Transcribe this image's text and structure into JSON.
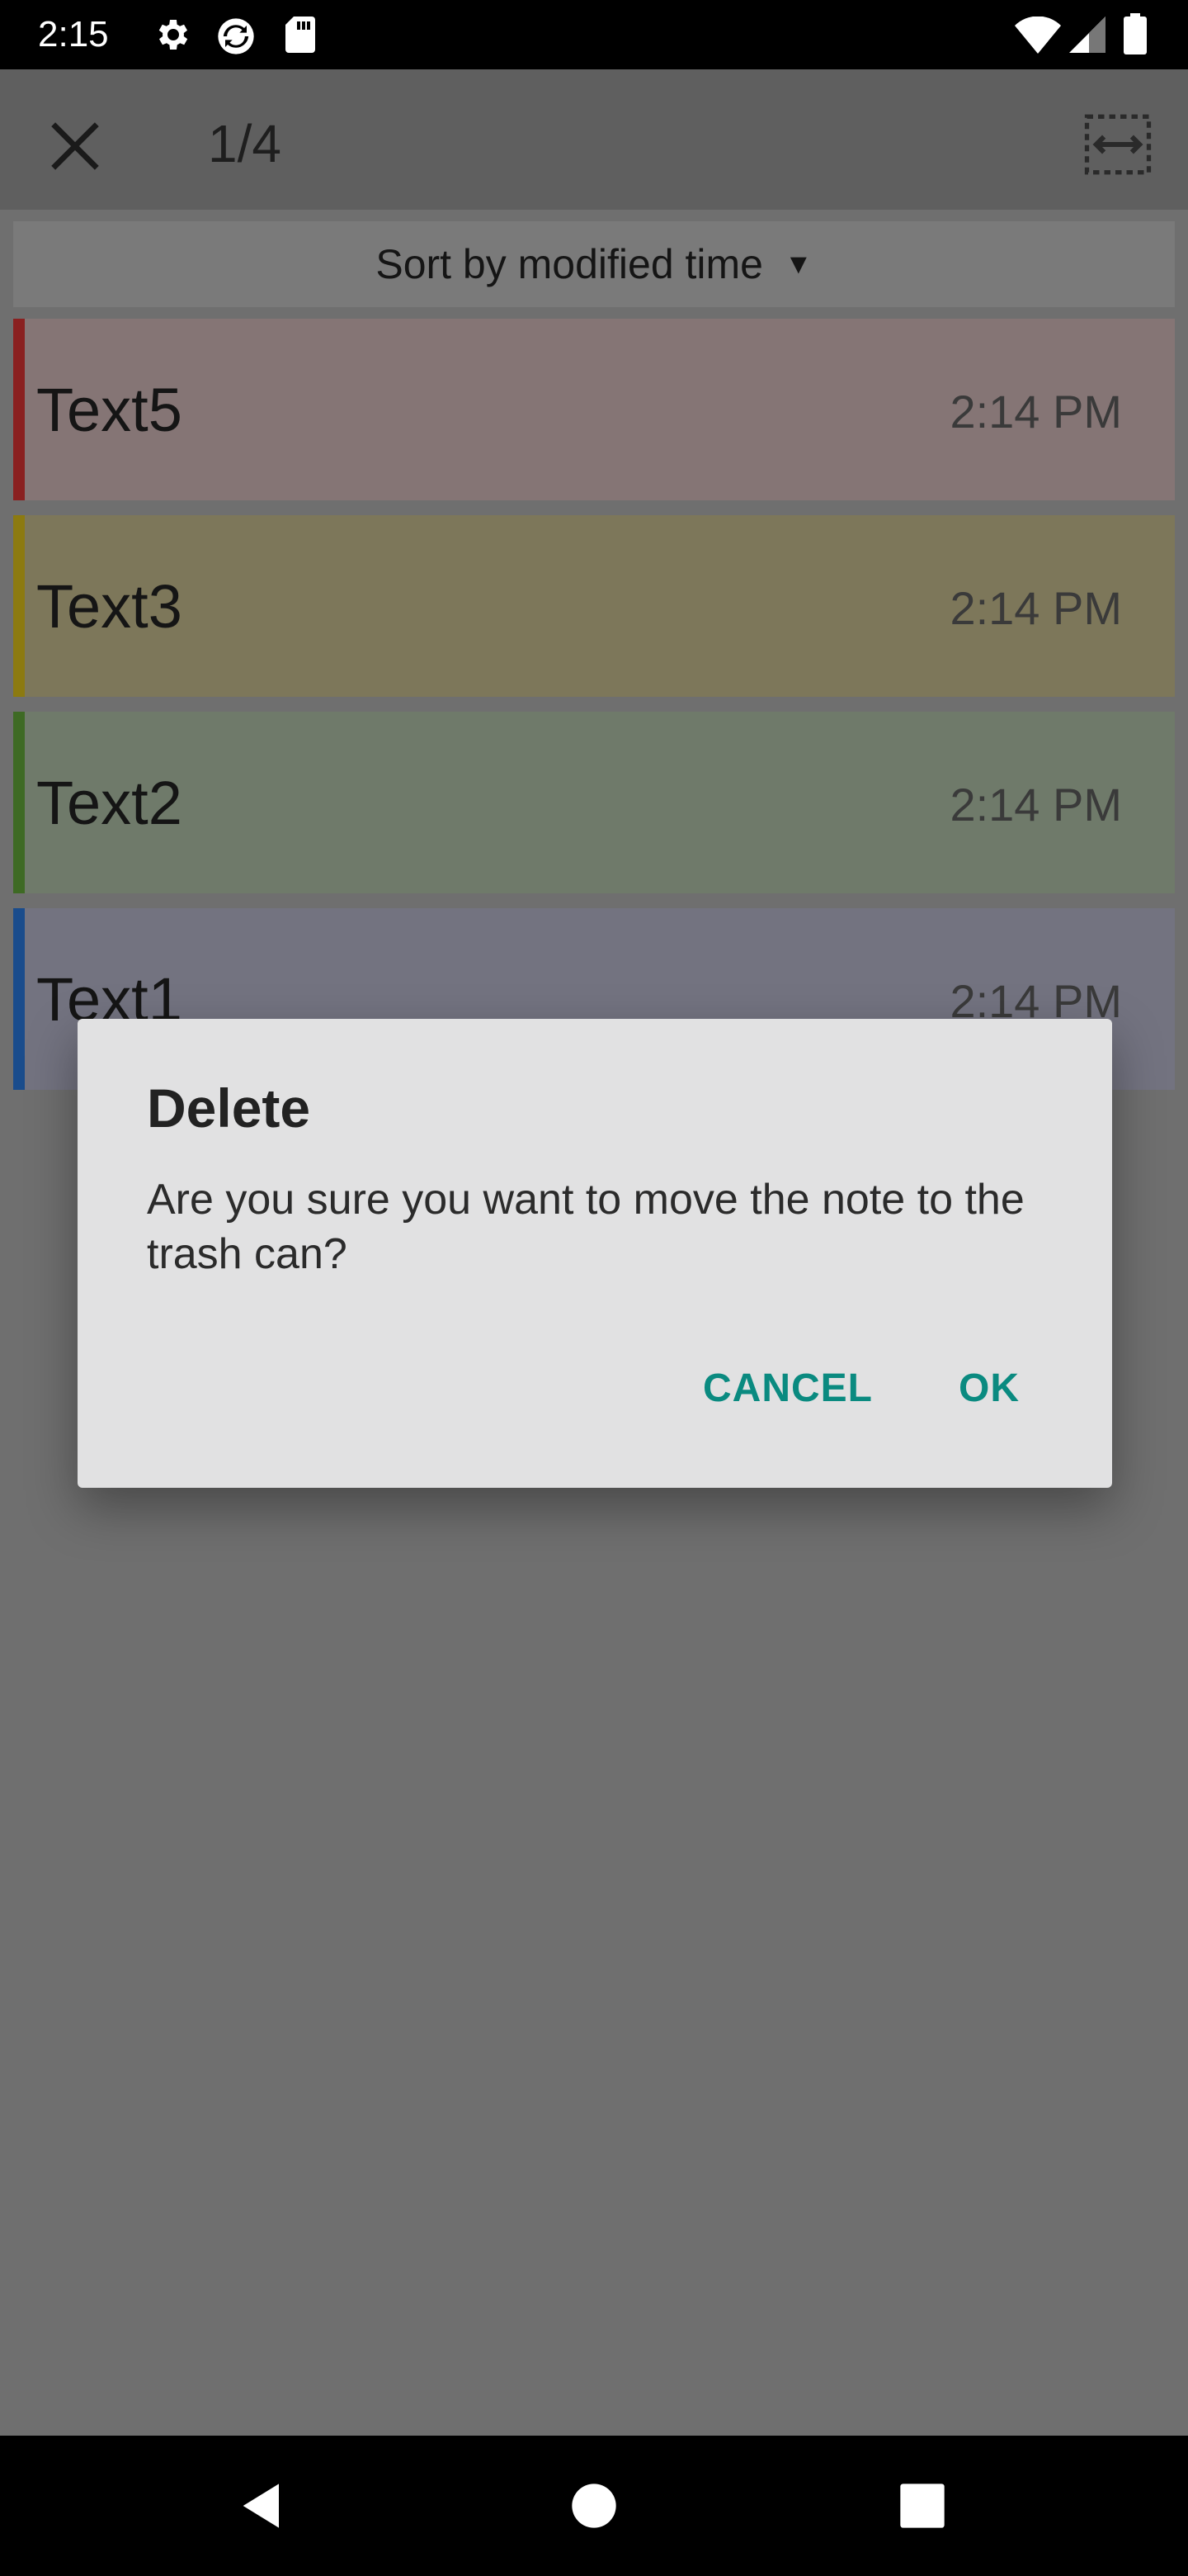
{
  "status_bar": {
    "time": "2:15",
    "icons": [
      "gear-icon",
      "sync-icon",
      "sd-card-icon",
      "wifi-icon",
      "signal-icon",
      "battery-icon"
    ]
  },
  "app_bar": {
    "counter": "1/4",
    "close_icon": "close-icon",
    "select_icon": "select-all-icon"
  },
  "sort": {
    "label": "Sort by modified time",
    "arrow": "▼"
  },
  "notes": [
    {
      "title": "Text5",
      "time": "2:14 PM",
      "bg": "#857575",
      "stripe": "#8a2020"
    },
    {
      "title": "Text3",
      "time": "2:14 PM",
      "bg": "#7d775a",
      "stripe": "#8c7a10"
    },
    {
      "title": "Text2",
      "time": "2:14 PM",
      "bg": "#6f7a6a",
      "stripe": "#3e6a24"
    },
    {
      "title": "Text1",
      "time": "2:14 PM",
      "bg": "#737380",
      "stripe": "#1a4c8c"
    }
  ],
  "dialog": {
    "title": "Delete",
    "message": "Are you sure you want to move the note to the trash can?",
    "cancel": "CANCEL",
    "ok": "OK",
    "accent": "#0a8a80"
  },
  "nav_bar": {
    "back": "back-icon",
    "home": "home-icon",
    "recents": "recents-icon"
  }
}
